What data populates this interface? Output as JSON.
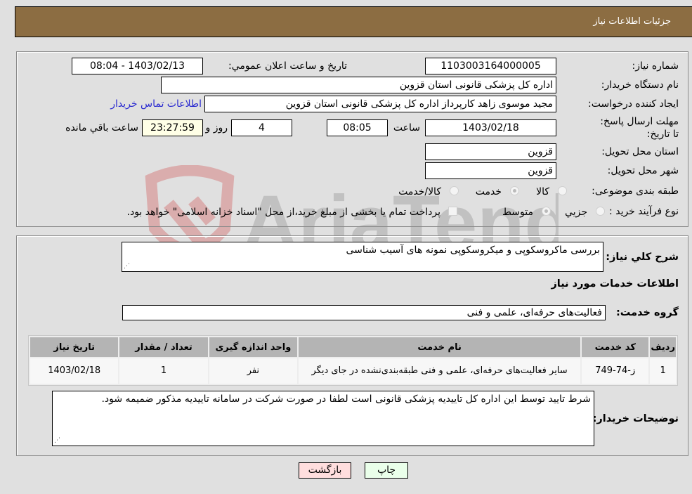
{
  "header": {
    "title": "جزئیات اطلاعات نیاز"
  },
  "details": {
    "need_number_label": "شماره نیاز:",
    "need_number": "1103003164000005",
    "announce_label": "تاریخ و ساعت اعلان عمومي:",
    "announce_value": "1403/02/13 - 08:04",
    "buyer_org_label": "نام دستگاه خریدار:",
    "buyer_org": "اداره کل پزشکی قانونی استان قزوین",
    "creator_label": "ایجاد کننده درخواست:",
    "creator": "مجید موسوی زاهد کارپرداز اداره کل پزشکی قانونی استان قزوین",
    "contact_link": "اطلاعات تماس خریدار",
    "deadline_label": "مهلت ارسال پاسخ: تا تاریخ:",
    "deadline_date": "1403/02/18",
    "time_label": "ساعت",
    "deadline_time": "08:05",
    "days": "4",
    "days_label": "روز و",
    "remaining": "23:27:59",
    "remaining_label": "ساعت باقي مانده",
    "province_label": "استان محل تحویل:",
    "province": "قزوین",
    "city_label": "شهر محل تحویل:",
    "city": "قزوین",
    "category_label": "طبقه بندی موضوعی:",
    "category_options": [
      "کالا",
      "خدمت",
      "کالا/خدمت"
    ],
    "category_selected": "خدمت",
    "process_label": "نوع فرآیند خرید :",
    "process_options": [
      "جزیي",
      "متوسط"
    ],
    "process_selected": "متوسط",
    "payment_note": "پرداخت تمام یا بخشی از مبلغ خرید،از محل \"اسناد خزانه اسلامی\" خواهد بود."
  },
  "needs": {
    "description_label": "شرح کلي نیاز:",
    "description": "بررسی ماکروسکوپی و میکروسکوپی نمونه های آسیب شناسی",
    "services_heading": "اطلاعات خدمات مورد نیاز",
    "service_group_label": "گروه خدمت:",
    "service_group": "فعالیت‌های حرفه‌ای، علمی و فنی",
    "table": {
      "headers": [
        "ردیف",
        "کد خدمت",
        "نام خدمت",
        "واحد اندازه گیری",
        "تعداد / مقدار",
        "تاریخ نیاز"
      ],
      "rows": [
        [
          "1",
          "ز-74-749",
          "سایر فعالیت‌های حرفه‌ای، علمی و فنی طبقه‌بندی‌نشده در جای دیگر",
          "نفر",
          "1",
          "1403/02/18"
        ]
      ]
    },
    "buyer_notes_label": "توضیحات خریدار:",
    "buyer_notes": "شرط تایید توسط این اداره کل تاییدیه پزشکی قانونی است لطفا در صورت شرکت در سامانه تاییدیه مذکور ضمیمه شود."
  },
  "buttons": {
    "print": "چاپ",
    "back": "بازگشت"
  },
  "colors": {
    "header_bg": "#8c6d42",
    "print_bg": "#eaffea",
    "back_bg": "#ffdede",
    "link": "#2a2ad0"
  }
}
